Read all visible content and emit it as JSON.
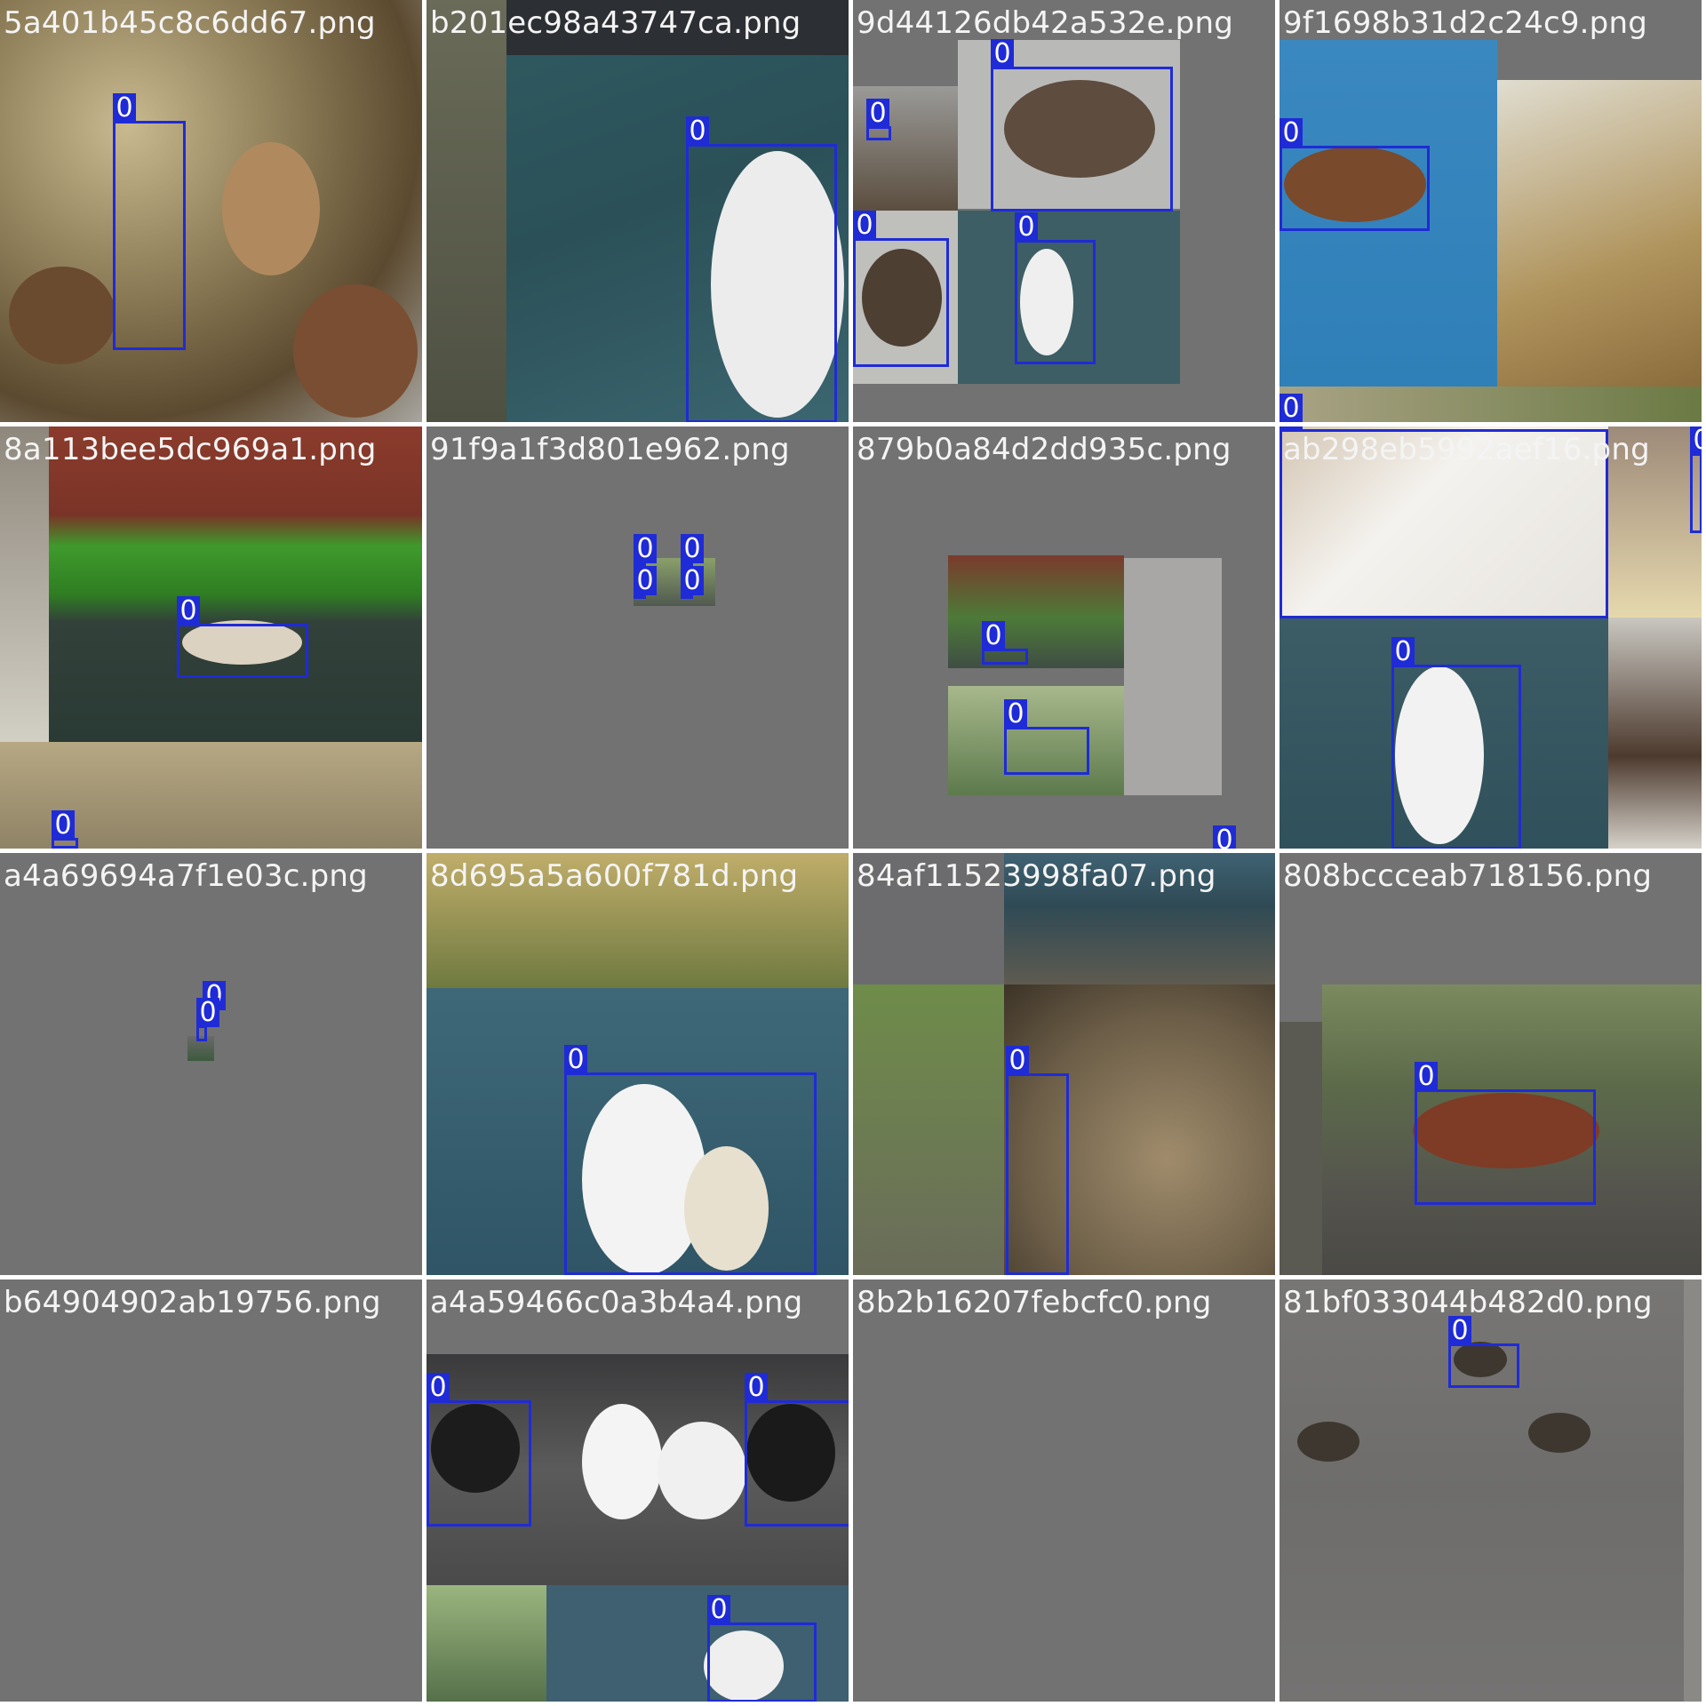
{
  "mosaic": {
    "background_color": "#ffffff",
    "tile_gray": "#727272",
    "box_color": "#1f2bd6",
    "label_text_color": "#ffffff",
    "tiles": [
      {
        "id": "t0",
        "filename": "5a401b45c8c6dd67.png",
        "labels": [
          "0"
        ]
      },
      {
        "id": "t1",
        "filename": "b201ec98a43747ca.png",
        "labels": [
          "0"
        ]
      },
      {
        "id": "t2",
        "filename": "9d44126db42a532e.png",
        "labels": [
          "0",
          "0",
          "0",
          "0"
        ]
      },
      {
        "id": "t3",
        "filename": "9f1698b31d2c24c9.png",
        "labels": [
          "0",
          "0"
        ]
      },
      {
        "id": "t4",
        "filename": "8a113bee5dc969a1.png",
        "labels": [
          "0",
          "0"
        ]
      },
      {
        "id": "t5",
        "filename": "91f9a1f3d801e962.png",
        "labels": [
          "0",
          "0",
          "0",
          "0"
        ]
      },
      {
        "id": "t6",
        "filename": "879b0a84d2dd935c.png",
        "labels": [
          "0",
          "0",
          "0"
        ]
      },
      {
        "id": "t7",
        "filename": "ab298eb5992aef16.png",
        "labels": [
          "0",
          "0",
          "0"
        ]
      },
      {
        "id": "t8",
        "filename": "a4a69694a7f1e03c.png",
        "labels": [
          "0",
          "0"
        ]
      },
      {
        "id": "t9",
        "filename": "8d695a5a600f781d.png",
        "labels": [
          "0"
        ]
      },
      {
        "id": "t10",
        "filename": "84af11523998fa07.png",
        "labels": [
          "0"
        ]
      },
      {
        "id": "t11",
        "filename": "808bccceab718156.png",
        "labels": [
          "0"
        ]
      },
      {
        "id": "t12",
        "filename": "b64904902ab19756.png",
        "labels": []
      },
      {
        "id": "t13",
        "filename": "a4a59466c0a3b4a4.png",
        "labels": [
          "0",
          "0",
          "0"
        ]
      },
      {
        "id": "t14",
        "filename": "8b2b16207febcfc0.png",
        "labels": []
      },
      {
        "id": "t15",
        "filename": "81bf033044b482d0.png",
        "labels": [
          "0"
        ]
      }
    ]
  }
}
